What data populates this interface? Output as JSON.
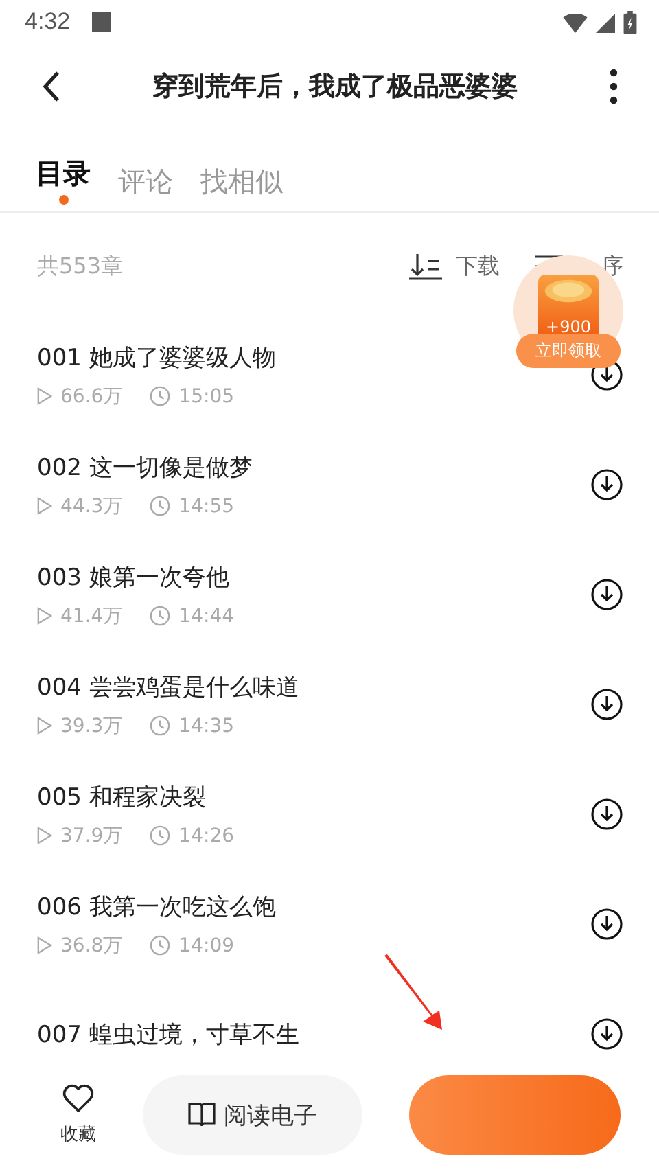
{
  "status_bar": {
    "time": "4:32"
  },
  "header": {
    "title": "穿到荒年后，我成了极品恶婆婆"
  },
  "tabs": [
    {
      "label": "目录",
      "selected": true
    },
    {
      "label": "评论",
      "selected": false
    },
    {
      "label": "找相似",
      "selected": false
    }
  ],
  "toolbar": {
    "count": "共553章",
    "download": "下载",
    "sort": "序"
  },
  "chapters": [
    {
      "title": "001 她成了婆婆级人物",
      "plays": "66.6万",
      "duration": "15:05"
    },
    {
      "title": "002 这一切像是做梦",
      "plays": "44.3万",
      "duration": "14:55"
    },
    {
      "title": "003 娘第一次夸他",
      "plays": "41.4万",
      "duration": "14:44"
    },
    {
      "title": "004 尝尝鸡蛋是什么味道",
      "plays": "39.3万",
      "duration": "14:35"
    },
    {
      "title": "005 和程家决裂",
      "plays": "37.9万",
      "duration": "14:26"
    },
    {
      "title": "006 我第一次吃这么饱",
      "plays": "36.8万",
      "duration": "14:09"
    },
    {
      "title": "007 蝗虫过境，寸草不生"
    }
  ],
  "reward": {
    "amount": "+900",
    "action": "立即领取"
  },
  "bottom_bar": {
    "favorite": "收藏",
    "read": "阅读电子"
  }
}
